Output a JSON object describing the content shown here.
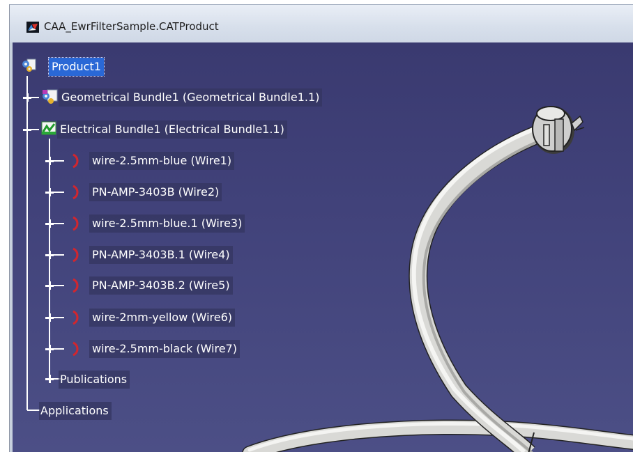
{
  "window": {
    "title": "CAA_EwrFilterSample.CATProduct",
    "background_top": "#3a3a70",
    "background_bottom": "#4c4f86"
  },
  "tree": {
    "root": {
      "label": "Product1",
      "selected": true,
      "icon": "product-icon"
    },
    "geometrical_bundle": {
      "label": "Geometrical Bundle1 (Geometrical Bundle1.1)",
      "icon": "geometrical-bundle-icon",
      "expanded": false
    },
    "electrical_bundle": {
      "label": "Electrical Bundle1 (Electrical Bundle1.1)",
      "icon": "electrical-bundle-icon",
      "expanded": true
    },
    "wires": [
      {
        "label": "wire-2.5mm-blue (Wire1)",
        "icon": "wire-icon"
      },
      {
        "label": "PN-AMP-3403B (Wire2)",
        "icon": "wire-icon"
      },
      {
        "label": "wire-2.5mm-blue.1 (Wire3)",
        "icon": "wire-icon"
      },
      {
        "label": "PN-AMP-3403B.1 (Wire4)",
        "icon": "wire-icon"
      },
      {
        "label": "PN-AMP-3403B.2 (Wire5)",
        "icon": "wire-icon"
      },
      {
        "label": "wire-2mm-yellow (Wire6)",
        "icon": "wire-icon"
      },
      {
        "label": "wire-2.5mm-black (Wire7)",
        "icon": "wire-icon"
      }
    ],
    "publications": {
      "label": "Publications"
    },
    "applications": {
      "label": "Applications"
    }
  },
  "colors": {
    "selection": "#2a68d6",
    "wire_icon": "#d1262e",
    "cable": "#d9d9d6"
  }
}
